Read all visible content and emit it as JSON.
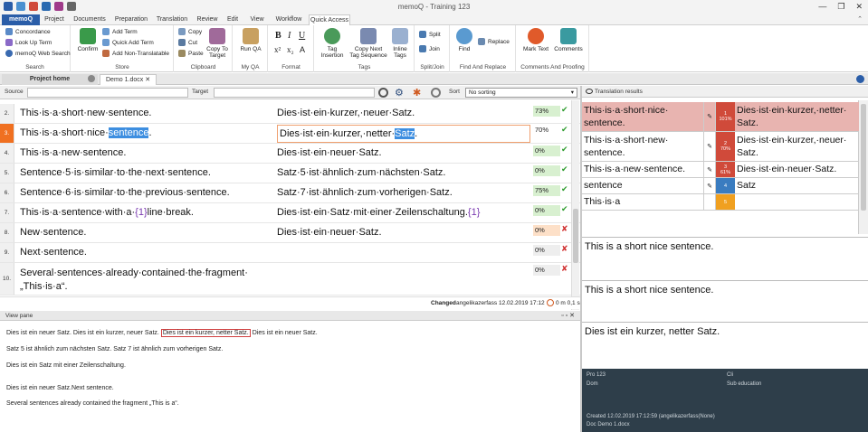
{
  "titlebar": {
    "title": "memoQ - Training 123"
  },
  "tabs": [
    "memoQ",
    "Project",
    "Documents",
    "Preparation",
    "Translation",
    "Review",
    "Edit",
    "View",
    "Workflow",
    "Quick Access"
  ],
  "ribbon": {
    "search": {
      "items": [
        "Concordance",
        "Look Up Term",
        "memoQ Web Search"
      ],
      "label": "Search"
    },
    "store": {
      "confirm": "Confirm",
      "items": [
        "Add Term",
        "Quick Add Term",
        "Add Non-Translatable"
      ],
      "label": "Store"
    },
    "clipboard": {
      "items": [
        "Copy",
        "Cut",
        "Paste"
      ],
      "copy_to_target": "Copy To Target",
      "label": "Clipboard"
    },
    "myqa": {
      "run": "Run QA",
      "label": "My QA"
    },
    "format": {
      "label": "Format"
    },
    "tags": {
      "items": [
        "Tag Insertion",
        "Copy Next Tag Sequence",
        "Inline Tags"
      ],
      "label": "Tags"
    },
    "splitjoin": {
      "split": "Split",
      "join": "Join",
      "label": "Split/Join"
    },
    "findreplace": {
      "find": "Find",
      "replace": "Replace",
      "label": "Find And Replace"
    },
    "comments": {
      "mark": "Mark Text",
      "comments": "Comments",
      "label": "Comments And Proofing"
    }
  },
  "doctabs": [
    "Project home",
    "Demo 1.docx"
  ],
  "filter": {
    "source": "Source",
    "target": "Target",
    "sort": "Sort",
    "sort_value": "No sorting"
  },
  "rows": [
    {
      "num": "2.",
      "src": "This·is·a·short·new·sentence.",
      "tgt": "Dies·ist·ein·kurzer,·neuer·Satz.",
      "status": "73%",
      "status_bg": "#d8f0d0",
      "icon": "✔",
      "icon_color": "#2a9a2a"
    },
    {
      "num": "3.",
      "src_pre": "This·is·a·short·nice·",
      "src_hl": "sentence",
      "src_post": ".",
      "tgt_pre": "Dies·ist·ein·kurzer,·netter·",
      "tgt_hl": "Satz",
      "tgt_post": ".",
      "status": "70%",
      "status_bg": "#fff",
      "icon": "✔",
      "icon_color": "#2a9a2a"
    },
    {
      "num": "4.",
      "src": "This·is·a·new·sentence.",
      "tgt": "Dies·ist·ein·neuer·Satz.",
      "status": "0%",
      "status_bg": "#d8f0d0",
      "icon": "✔",
      "icon_color": "#2a9a2a"
    },
    {
      "num": "5.",
      "src": "Sentence·5·is·similar·to·the·next·sentence.",
      "tgt": "Satz·5·ist·ähnlich·zum·nächsten·Satz.",
      "status": "0%",
      "status_bg": "#d8f0d0",
      "icon": "✔",
      "icon_color": "#2a9a2a"
    },
    {
      "num": "6.",
      "src": "Sentence·6·is·similar·to·the·previous·sentence.",
      "tgt": "Satz·7·ist·ähnlich·zum·vorherigen·Satz.",
      "status": "75%",
      "status_bg": "#d8f0d0",
      "icon": "✔",
      "icon_color": "#2a9a2a"
    },
    {
      "num": "7.",
      "src_pre": "This·is·a·sentence·with·a·",
      "src_tag": "{1}",
      "src_post": "line·break.",
      "tgt_pre": "Dies·ist·ein·Satz·mit·einer·Zeilenschaltung.",
      "tgt_tag": "{1}",
      "tgt_post": "",
      "status": "0%",
      "status_bg": "#d8f0d0",
      "icon": "✔",
      "icon_color": "#2a9a2a"
    },
    {
      "num": "8.",
      "src": "New·sentence.",
      "tgt": "Dies·ist·ein·neuer·Satz.",
      "status": "0%",
      "status_bg": "#fde0c8",
      "icon": "✘",
      "icon_color": "#d03030"
    },
    {
      "num": "9.",
      "src": "Next·sentence.",
      "tgt": "",
      "status": "0%",
      "status_bg": "#eee",
      "icon": "✘",
      "icon_color": "#d03030"
    },
    {
      "num": "10.",
      "src": "Several·sentences·already·contained·the·fragment·",
      "src2": "„This·is·a“.",
      "tgt": "",
      "status": "0%",
      "status_bg": "#eee",
      "icon": "✘",
      "icon_color": "#d03030"
    }
  ],
  "statusbar": {
    "state": "Changed",
    "user": "angelikazerfass 12.02.2019 17:12",
    "time": "0 m 0,1 s"
  },
  "viewpane": {
    "title": "View pane",
    "line1_pre": "Dies ist ein neuer Satz. Dies ist ein kurzer, neuer Satz.",
    "line1_box": "Dies ist ein kurzer, netter Satz.",
    "line1_post": "Dies ist ein neuer Satz.",
    "line2": "Satz 5 ist ähnlich zum nächsten Satz. Satz 7 ist ähnlich zum vorherigen Satz.",
    "line3": "Dies ist ein Satz mit einer Zeilenschaltung.",
    "line4": "Dies ist ein neuer Satz.Next sentence.",
    "line5": "Several sentences already contained the fragment „This is a“."
  },
  "results": {
    "title": "Translation results",
    "items": [
      {
        "src": "This·is·a·short·nice· sentence.",
        "num": "1",
        "pct": "101%",
        "color": "#d04a3a",
        "tgt": "Dies·ist·ein·kurzer,·netter· Satz.",
        "bg": "#e8b4b0"
      },
      {
        "src": "This·is·a·short·new· sentence.",
        "num": "2",
        "pct": "70%",
        "color": "#d04a3a",
        "tgt": "Dies·ist·ein·kurzer,·neuer· Satz.",
        "bg": "#fff"
      },
      {
        "src": "This·is·a·new·sentence.",
        "num": "3",
        "pct": "61%",
        "color": "#d04a3a",
        "tgt": "Dies·ist·ein·neuer·Satz.",
        "bg": "#fff"
      },
      {
        "src": "sentence",
        "num": "4",
        "pct": "",
        "color": "#3a7cc0",
        "tgt": "Satz",
        "bg": "#fff"
      },
      {
        "src": "This·is·a",
        "num": "5",
        "pct": "",
        "color": "#f0a020",
        "tgt": "",
        "bg": "#fff"
      }
    ],
    "pane1": "This is a short nice sentence.",
    "pane2": "This is a short nice sentence.",
    "pane3": "Dies ist ein kurzer, netter Satz."
  },
  "meta": {
    "pro": "Pro 123",
    "cli": "Cli",
    "dom": "Dom",
    "sub": "Sub education",
    "created": "Created 12.02.2019 17:12:59 (angelikazerfass(None)",
    "doc": "Doc Demo 1.docx"
  }
}
